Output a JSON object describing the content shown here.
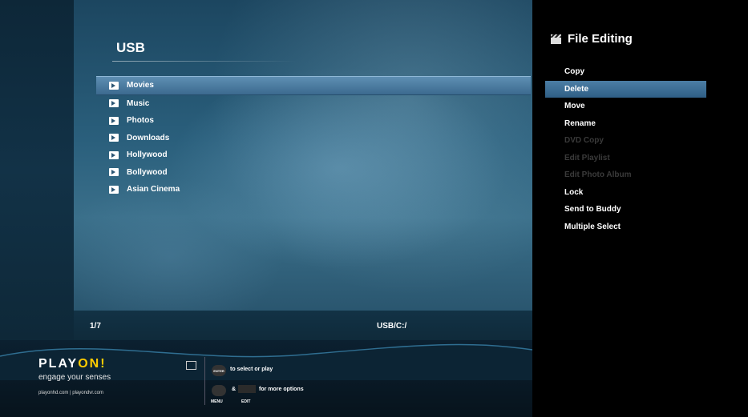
{
  "browser": {
    "title": "USB",
    "items": [
      {
        "label": "Movies",
        "selected": true
      },
      {
        "label": "Music"
      },
      {
        "label": "Photos"
      },
      {
        "label": "Downloads"
      },
      {
        "label": "Hollywood"
      },
      {
        "label": "Bollywood"
      },
      {
        "label": "Asian Cinema"
      }
    ],
    "counter": "1/7",
    "path": "USB/C:/"
  },
  "brand": {
    "logo_a": "PLAY",
    "logo_b": "ON!",
    "tagline": "engage your senses",
    "urls": "playonhd.com | playondvr.com",
    "accent": "#ffcc00"
  },
  "hints": {
    "enter_btn": "ENTER",
    "select_text": "to select or play",
    "amp": "&",
    "options_text": "for more options",
    "menu_label": "MENU",
    "edit_label": "EDIT"
  },
  "panel": {
    "title": "File Editing",
    "icon": "clapperboard-icon",
    "items": [
      {
        "label": "Copy",
        "enabled": true
      },
      {
        "label": "Delete",
        "enabled": true,
        "selected": true
      },
      {
        "label": "Move",
        "enabled": true
      },
      {
        "label": "Rename",
        "enabled": true
      },
      {
        "label": "DVD Copy",
        "enabled": false
      },
      {
        "label": "Edit Playlist",
        "enabled": false
      },
      {
        "label": "Edit Photo Album",
        "enabled": false
      },
      {
        "label": "Lock",
        "enabled": true
      },
      {
        "label": "Send to Buddy",
        "enabled": true
      },
      {
        "label": "Multiple Select",
        "enabled": true
      }
    ]
  }
}
